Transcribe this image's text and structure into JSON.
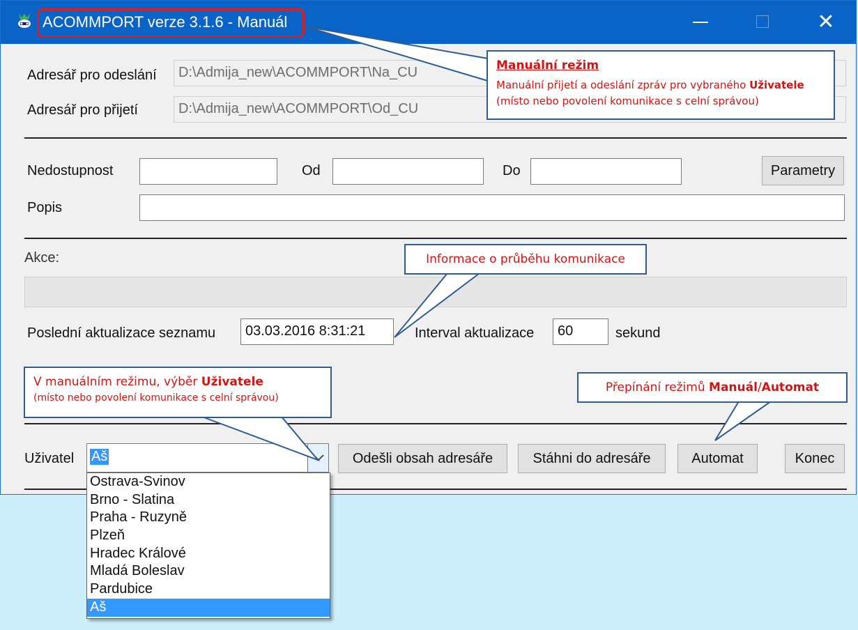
{
  "window": {
    "title": "ACOMMPORT verze 3.1.6 - Manuál",
    "close_glyph": "✕"
  },
  "directories": {
    "send_label": "Adresář pro odeslání",
    "send_value": "D:\\Admija_new\\ACOMMPORT\\Na_CU",
    "receive_label": "Adresář pro přijetí",
    "receive_value": "D:\\Admija_new\\ACOMMPORT\\Od_CU"
  },
  "unavailability": {
    "label": "Nedostupnost",
    "value": "",
    "from_label": "Od",
    "from_value": "",
    "to_label": "Do",
    "to_value": "",
    "params_button": "Parametry",
    "description_label": "Popis",
    "description_value": ""
  },
  "action": {
    "label": "Akce:",
    "last_update_label": "Poslední aktualizace seznamu",
    "last_update_value": "03.03.2016 8:31:21",
    "interval_label": "Interval aktualizace",
    "interval_value": "60",
    "interval_unit": "sekund"
  },
  "user": {
    "label": "Uživatel",
    "selected": "Aš",
    "options": [
      "Ostrava-Svinov",
      "Brno - Slatina",
      "Praha - Ruzyně",
      "Plzeň",
      "Hradec Králové",
      "Mladá Boleslav",
      "Pardubice",
      "Aš"
    ],
    "selected_index": 7
  },
  "buttons": {
    "send_dir": "Odešli obsah adresáře",
    "download_dir": "Stáhni do adresáře",
    "automat": "Automat",
    "end": "Konec"
  },
  "callouts": {
    "manual_mode": {
      "title": "Manuální režim",
      "text_before": "Manuální přijetí a odeslání zpráv pro vybraného",
      "text_bold": "Uživatele",
      "text_after": "(místo nebo povolení komunikace s celní správou)"
    },
    "info": {
      "text": "Informace o průběhu komunikace"
    },
    "user_select": {
      "text_before": "V manuálním režimu, výběr",
      "text_bold": "Uživatele",
      "text_after": "(místo nebo povolení komunikace s celní správou)"
    },
    "mode_switch": {
      "text_before": "Přepínání režimů",
      "bold1": "Manuál",
      "slash": "/",
      "bold2": "Automat"
    }
  },
  "colors": {
    "titlebar": "#0a64c8",
    "highlight_frame": "#e01e1e",
    "callout_text": "#d01515",
    "callout_border": "#2f5c8e",
    "selection": "#3399ff",
    "desktop": "#cdeffb"
  }
}
